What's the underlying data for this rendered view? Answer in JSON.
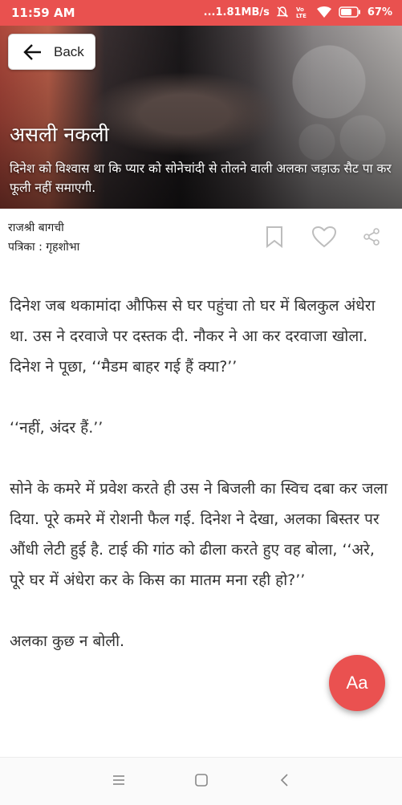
{
  "status": {
    "time": "11:59 AM",
    "network": "...1.81MB/s",
    "battery": "67%",
    "icons": [
      "mute-icon",
      "volte-icon",
      "wifi-icon",
      "battery-icon"
    ]
  },
  "header": {
    "back_label": "Back",
    "title": "असली नकली",
    "subtitle": "दिनेश को विश्वास था कि प्यार को सोनेचांदी से तोलने वाली अलका जड़ाऊ सैट पा कर फूली नहीं समाएगी."
  },
  "meta": {
    "author": "राजश्री बागची",
    "magazine": "पत्रिका : गृहशोभा"
  },
  "actions": [
    "bookmark-icon",
    "heart-icon",
    "share-icon"
  ],
  "article": {
    "paragraphs": [
      "दिनेश जब थकामांदा औफिस से घर पहुंचा तो घर में बिलकुल अंधेरा था. उस ने दरवाजे पर दस्तक दी. नौकर ने आ कर दरवाजा खोला. दिनेश ने पूछा, ‘‘मैडम बाहर गई हैं क्या?’’",
      "‘‘नहीं, अंदर हैं.’’",
      "सोने के कमरे में प्रवेश करते ही उस ने बिजली का स्विच दबा कर जला दिया. पूरे कमरे में रोशनी फैल गई. दिनेश ने देखा, अलका बिस्तर पर औंधी लेटी हुई है. टाई की गांठ को ढीला करते हुए वह बोला, ‘‘अरे, पूरे घर में अंधेरा कर के किस का मातम मना रही हो?’’",
      "अलका कुछ न बोली."
    ]
  },
  "fab": {
    "label": "Aa"
  },
  "colors": {
    "accent": "#e9514f",
    "fab": "#ea5150",
    "text": "#333333"
  }
}
